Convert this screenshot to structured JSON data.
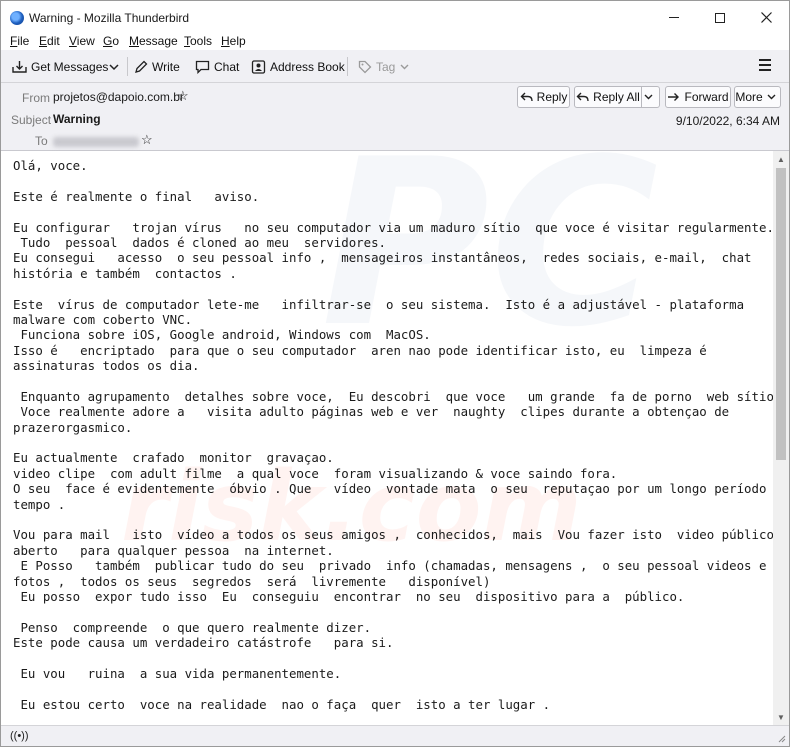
{
  "window": {
    "title": "Warning - Mozilla Thunderbird",
    "minimize_glyph": "—",
    "maximize_glyph": "☐",
    "close_glyph": "✕"
  },
  "menu": {
    "items": [
      {
        "u": "F",
        "rest": "ile"
      },
      {
        "u": "E",
        "rest": "dit"
      },
      {
        "u": "V",
        "rest": "iew"
      },
      {
        "u": "G",
        "rest": "o"
      },
      {
        "u": "M",
        "rest": "essage"
      },
      {
        "u": "T",
        "rest": "ools"
      },
      {
        "u": "H",
        "rest": "elp"
      }
    ]
  },
  "toolbar": {
    "get_messages": "Get Messages",
    "write": "Write",
    "chat": "Chat",
    "address_book": "Address Book",
    "tag": "Tag"
  },
  "header": {
    "from_label": "From",
    "from_value": "projetos@dapoio.com.br",
    "subject_label": "Subject",
    "subject_value": "Warning",
    "to_label": "To",
    "date": "9/10/2022, 6:34 AM",
    "reply": "Reply",
    "reply_all": "Reply All",
    "forward": "Forward",
    "more": "More"
  },
  "watermark": {
    "pc": "PC",
    "risk": "risk.com"
  },
  "body_lines": [
    "Olá, voce.",
    "",
    "Este é realmente o final   aviso.",
    "",
    "Eu configurar   trojan vírus   no seu computador via um maduro sítio  que voce é visitar regularmente.",
    " Tudo  pessoal  dados é cloned ao meu  servidores.",
    "Eu consegui   acesso  o seu pessoal info ,  mensageiros instantâneos,  redes sociais, e-mail,  chat",
    "história e também  contactos .",
    "",
    "Este  vírus de computador lete-me   infiltrar-se  o seu sistema.  Isto é a adjustável - plataforma",
    "malware com coberto VNC.",
    " Funciona sobre iOS, Google android, Windows com  MacOS.",
    "Isso é   encriptado  para que o seu computador  aren nao pode identificar isto, eu  limpeza é",
    "assinaturas todos os dia.",
    "",
    " Enquanto agrupamento  detalhes sobre voce,  Eu descobri  que voce   um grande  fa de porno  web sítios.",
    " Voce realmente adore a   visita adulto páginas web e ver  naughty  clipes durante a obtençao de",
    "prazerorgasmico.",
    "",
    "Eu actualmente  crafado  monitor  gravaçao.",
    "video clipe  com adult filme  a qual voce  foram visualizando & voce saindo fora.",
    "O seu  face é evidentemente  óbvio . Que   vídeo  vontade mata  o seu  reputaçao por um longo período de",
    "tempo .",
    "",
    "Vou para mail   isto  vídeo a todos os seus amigos ,  conhecidos,  mais  Vou fazer isto  video público",
    "aberto   para qualquer pessoa  na internet.",
    " E Posso   também  publicar tudo do seu  privado  info (chamadas, mensagens ,  o seu pessoal videos e",
    "fotos ,  todos os seus  segredos  será  livremente   disponível)",
    " Eu posso  expor tudo isso  Eu  conseguiu  encontrar  no seu  dispositivo para a  público.",
    "",
    " Penso  compreende  o que quero realmente dizer.",
    "Este pode causa um verdadeiro catástrofe   para si.",
    "",
    " Eu vou   ruina  a sua vida permanentemente.",
    "",
    " Eu estou certo  voce na realidade  nao o faça  quer  isto a ter lugar ."
  ],
  "status": {
    "icon": "((•))"
  }
}
